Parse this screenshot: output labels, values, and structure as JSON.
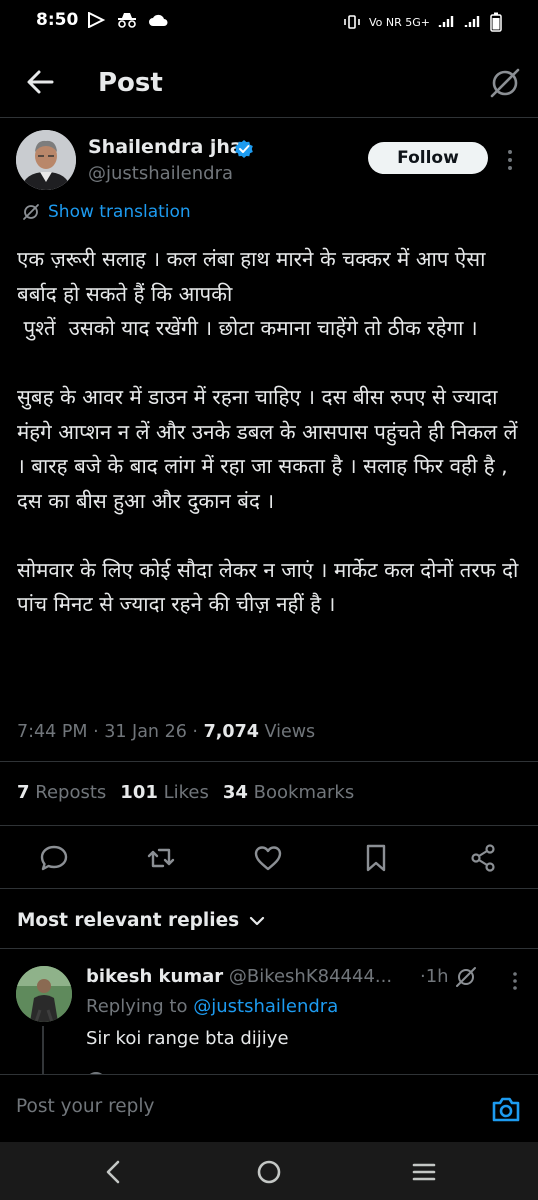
{
  "status_bar": {
    "time": "8:50",
    "right_text": "Vo NR 5G+"
  },
  "header": {
    "title": "Post"
  },
  "post": {
    "author_name": "Shailendra jha",
    "handle": "@justshailendra",
    "follow_label": "Follow",
    "show_translation": "Show translation",
    "text": "एक ज़रूरी सलाह । कल लंबा हाथ मारने के चक्कर में आप ऐसा बर्बाद हो सकते हैं कि आपकी\n पुश्तें  उसको याद रखेंगी । छोटा कमाना चाहेंगे तो ठीक रहेगा ।\n\nसुबह के आवर में डाउन में रहना चाहिए । दस बीस रुपए से ज्यादा मंहगे आप्शन न लें और उनके डबल के आसपास पहुंचते ही निकल लें । बारह बजे के बाद लांग में रहा जा सकता है । सलाह फिर वही है , दस का बीस हुआ और दुकान बंद ।\n\nसोमवार के लिए कोई सौदा लेकर न जाएं । मार्केट कल दोनों तरफ दो पांच मिनट से ज्यादा रहने की चीज़ नहीं है ।",
    "time": "7:44 PM",
    "date": "31 Jan 26",
    "views_count": "7,074",
    "views_label": "Views",
    "reposts_count": "7",
    "reposts_label": "Reposts",
    "likes_count": "101",
    "likes_label": "Likes",
    "bookmarks_count": "34",
    "bookmarks_label": "Bookmarks"
  },
  "replies_section": {
    "label": "Most relevant replies"
  },
  "reply": {
    "name": "bikesh kumar",
    "handle": "@BikeshK84444...",
    "age": "1h",
    "replying_prefix": "Replying to",
    "replying_handle": "@justshailendra",
    "text": "Sir koi range bta dijiye"
  },
  "composer": {
    "placeholder": "Post your reply"
  },
  "colors": {
    "accent": "#1d9bf0",
    "text": "#e7e9ea",
    "muted": "#71767b",
    "background": "#000000"
  }
}
